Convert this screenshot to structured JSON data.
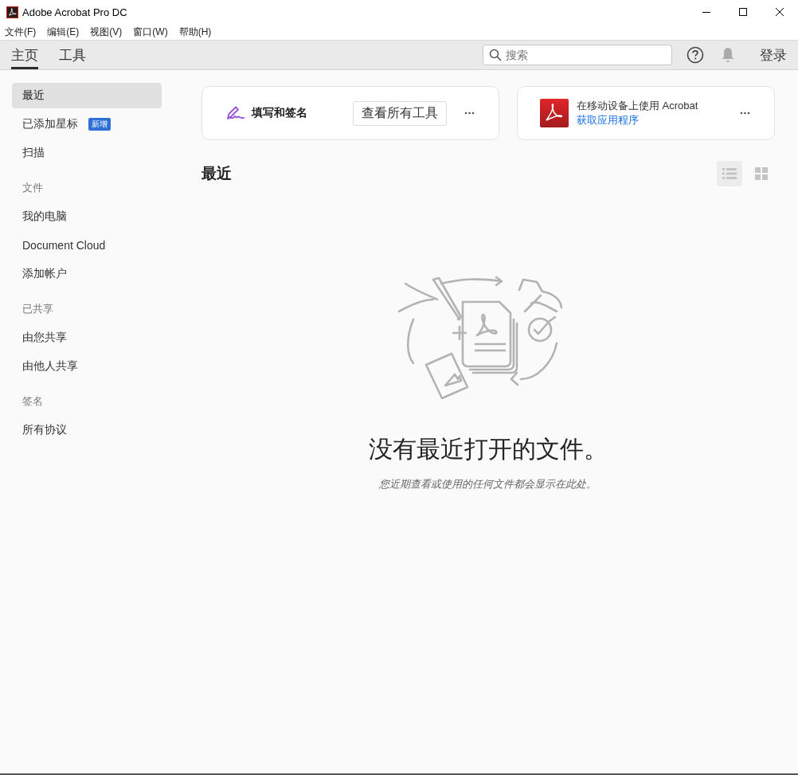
{
  "window": {
    "title": "Adobe Acrobat Pro DC"
  },
  "menu": [
    "文件(F)",
    "编辑(E)",
    "视图(V)",
    "窗口(W)",
    "帮助(H)"
  ],
  "tabs": [
    {
      "label": "主页",
      "selected": true
    },
    {
      "label": "工具",
      "selected": false
    }
  ],
  "search": {
    "placeholder": "搜索"
  },
  "login": "登录",
  "sidebar": {
    "items": [
      {
        "kind": "item",
        "label": "最近",
        "selected": true
      },
      {
        "kind": "item",
        "label": "已添加星标",
        "selected": false,
        "badge": "新增"
      },
      {
        "kind": "item",
        "label": "扫描",
        "selected": false
      },
      {
        "kind": "header",
        "label": "文件"
      },
      {
        "kind": "item",
        "label": "我的电脑",
        "selected": false
      },
      {
        "kind": "item",
        "label": "Document Cloud",
        "selected": false
      },
      {
        "kind": "item",
        "label": "添加帐户",
        "selected": false
      },
      {
        "kind": "header",
        "label": "已共享"
      },
      {
        "kind": "item",
        "label": "由您共享",
        "selected": false
      },
      {
        "kind": "item",
        "label": "由他人共享",
        "selected": false
      },
      {
        "kind": "header",
        "label": "签名"
      },
      {
        "kind": "item",
        "label": "所有协议",
        "selected": false
      }
    ]
  },
  "tool_card": {
    "label": "填写和签名",
    "button": "查看所有工具"
  },
  "mobile_card": {
    "title": "在移动设备上使用 Acrobat",
    "link": "获取应用程序"
  },
  "section": {
    "title": "最近",
    "views": [
      {
        "kind": "list",
        "selected": true
      },
      {
        "kind": "grid",
        "selected": false
      }
    ]
  },
  "empty_state": {
    "title": "没有最近打开的文件。",
    "subtitle": "您近期查看或使用的任何文件都会显示在此处。"
  }
}
